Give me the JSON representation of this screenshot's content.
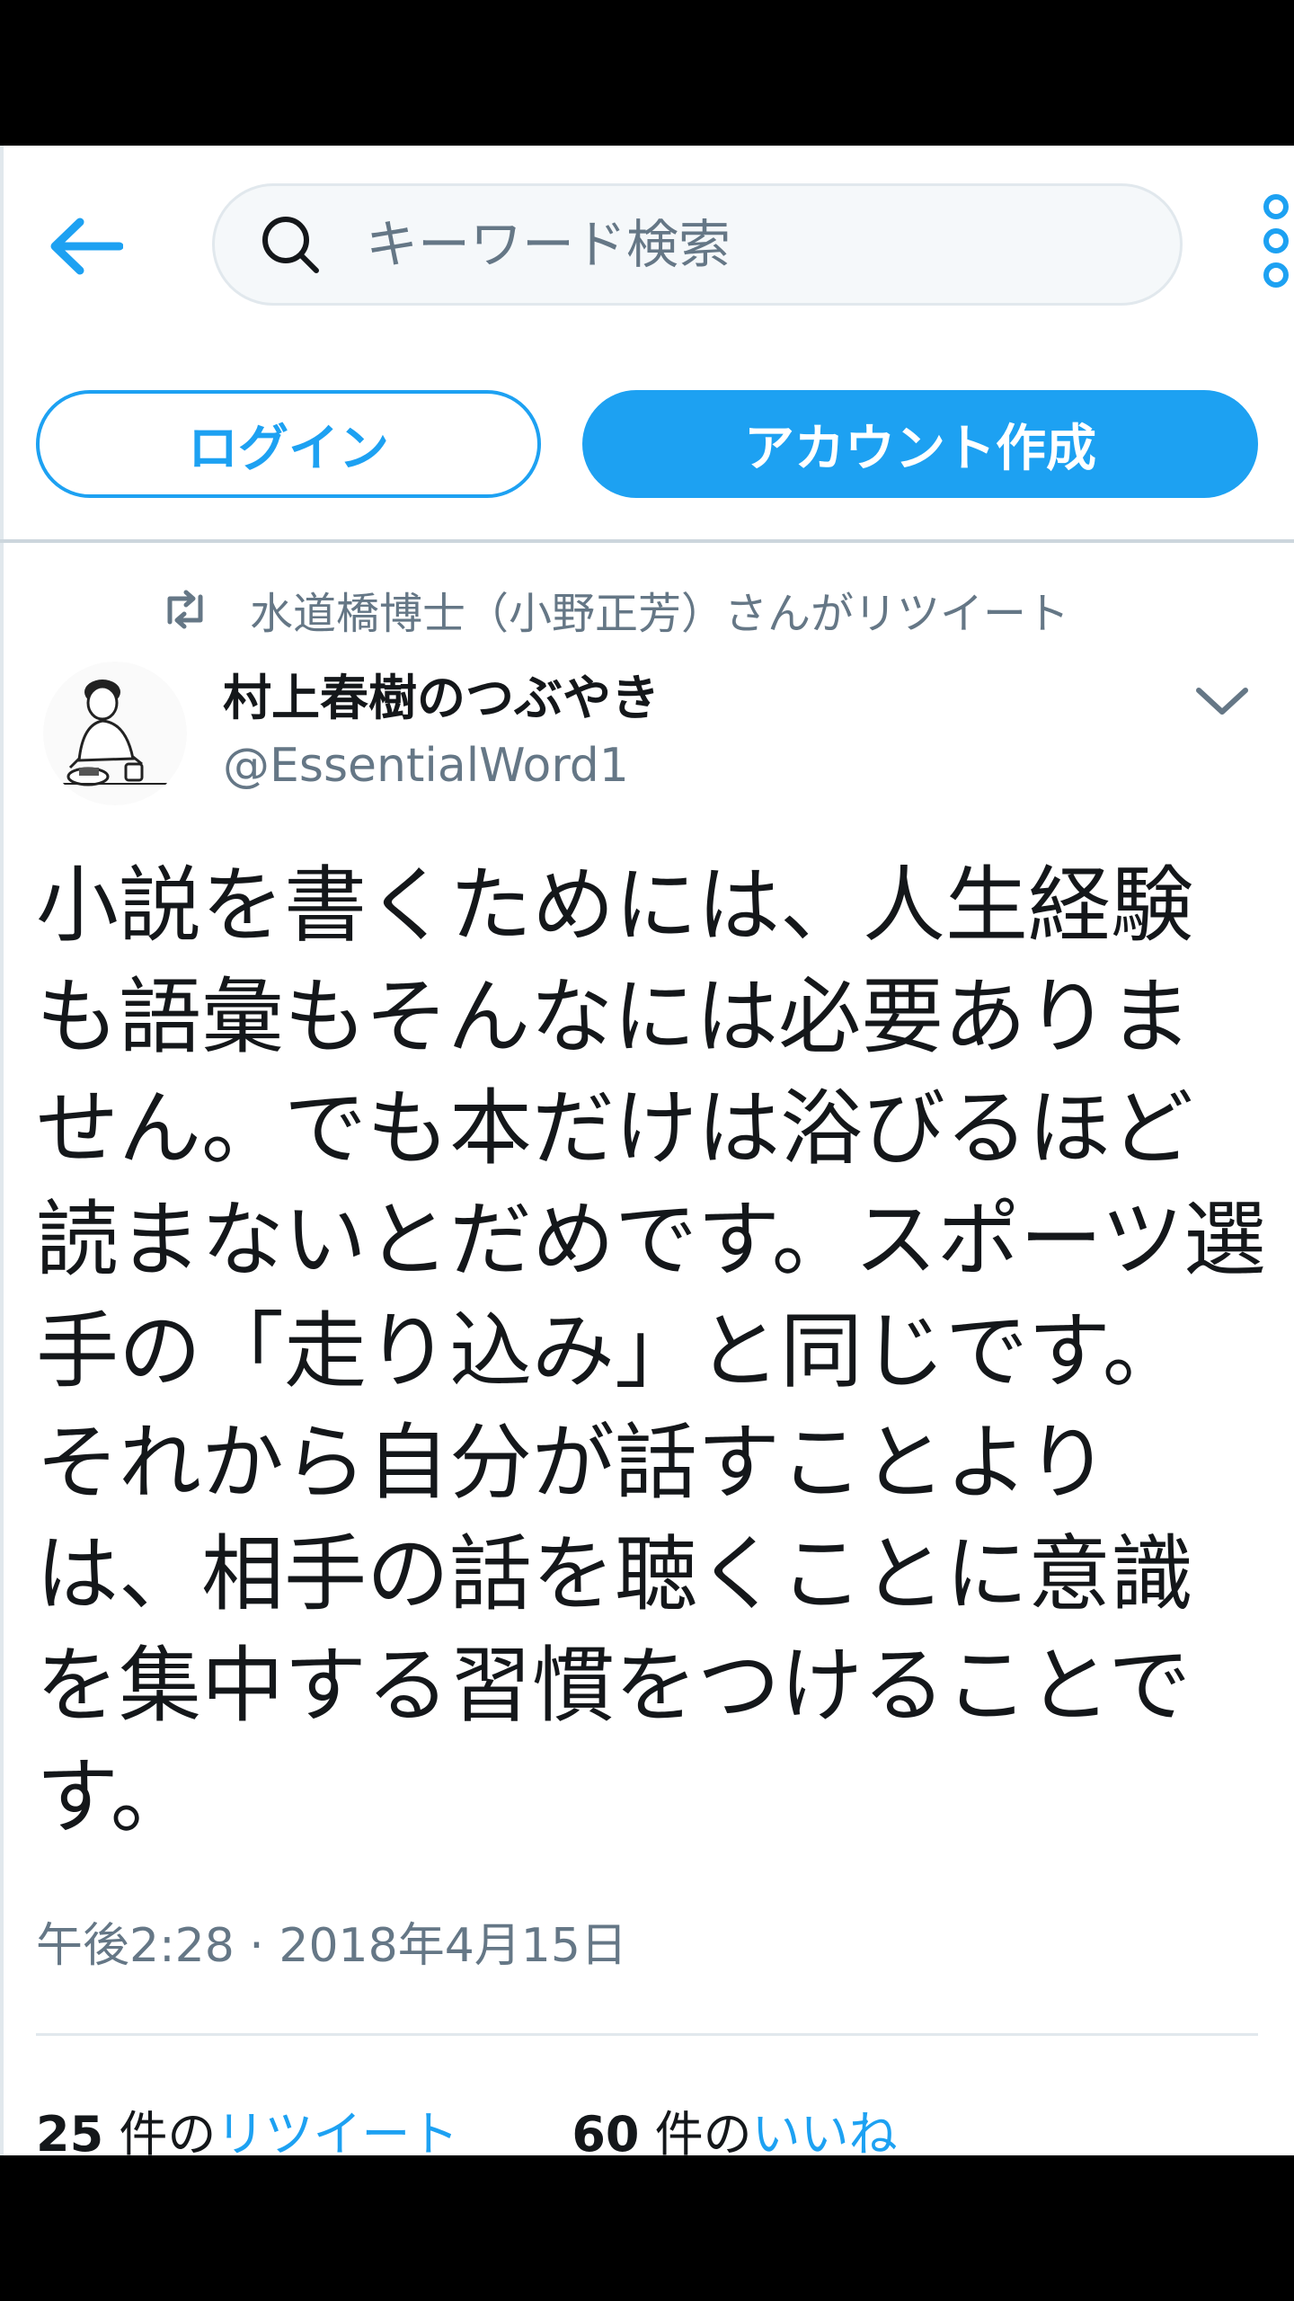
{
  "header": {
    "search_placeholder": "キーワード検索",
    "login_label": "ログイン",
    "signup_label": "アカウント作成"
  },
  "tweet": {
    "retweet_text": "水道橋博士（小野正芳）さんがリツイート",
    "user_name": "村上春樹のつぶやき",
    "user_handle": "@EssentialWord1",
    "text": "小説を書くためには、人生経験も語彙もそんなには必要ありません。でも本だけは浴びるほど読まないとだめです。スポーツ選手の「走り込み」と同じです。それから自分が話すことよりは、相手の話を聴くことに意識を集中する習慣をつけることです。",
    "timestamp": "午後2:28 · 2018年4月15日",
    "retweets_count": "25",
    "retweets_unit": "件の",
    "retweets_label": "リツイート",
    "likes_count": "60",
    "likes_unit": "件の",
    "likes_label": "いいね"
  },
  "icons": {
    "back": "arrow-left-icon",
    "search": "search-icon",
    "more": "more-vertical-icon",
    "retweet": "retweet-icon",
    "caret": "chevron-down-icon"
  },
  "colors": {
    "accent": "#1da1f2",
    "text": "#14171a",
    "secondary": "#657786",
    "border": "#e1e8ed"
  }
}
